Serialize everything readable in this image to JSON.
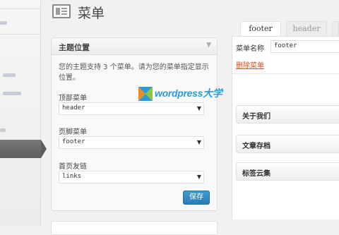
{
  "page": {
    "title": "菜单"
  },
  "theme_locations": {
    "title": "主题位置",
    "description": "您的主题支持 3 个菜单。请为您的菜单指定显示位置。",
    "fields": [
      {
        "label": "顶部菜单",
        "value": "header"
      },
      {
        "label": "页脚菜单",
        "value": "footer"
      },
      {
        "label": "首页友链",
        "value": "links"
      }
    ],
    "save_label": "保存"
  },
  "watermark": {
    "text": "wordpress大学"
  },
  "tabs": [
    {
      "label": "footer",
      "active": true
    },
    {
      "label": "header",
      "active": false
    }
  ],
  "menu_editor": {
    "name_label": "菜单名称",
    "name_value": "footer",
    "delete_label": "删除菜单",
    "items": [
      {
        "label": "关于我们"
      },
      {
        "label": "文章存档"
      },
      {
        "label": "标签云集"
      }
    ]
  },
  "colors": {
    "accent_blue": "#2a7cb3",
    "delete_red": "#d54e21",
    "sidebar_active": "#5e5e5e"
  }
}
